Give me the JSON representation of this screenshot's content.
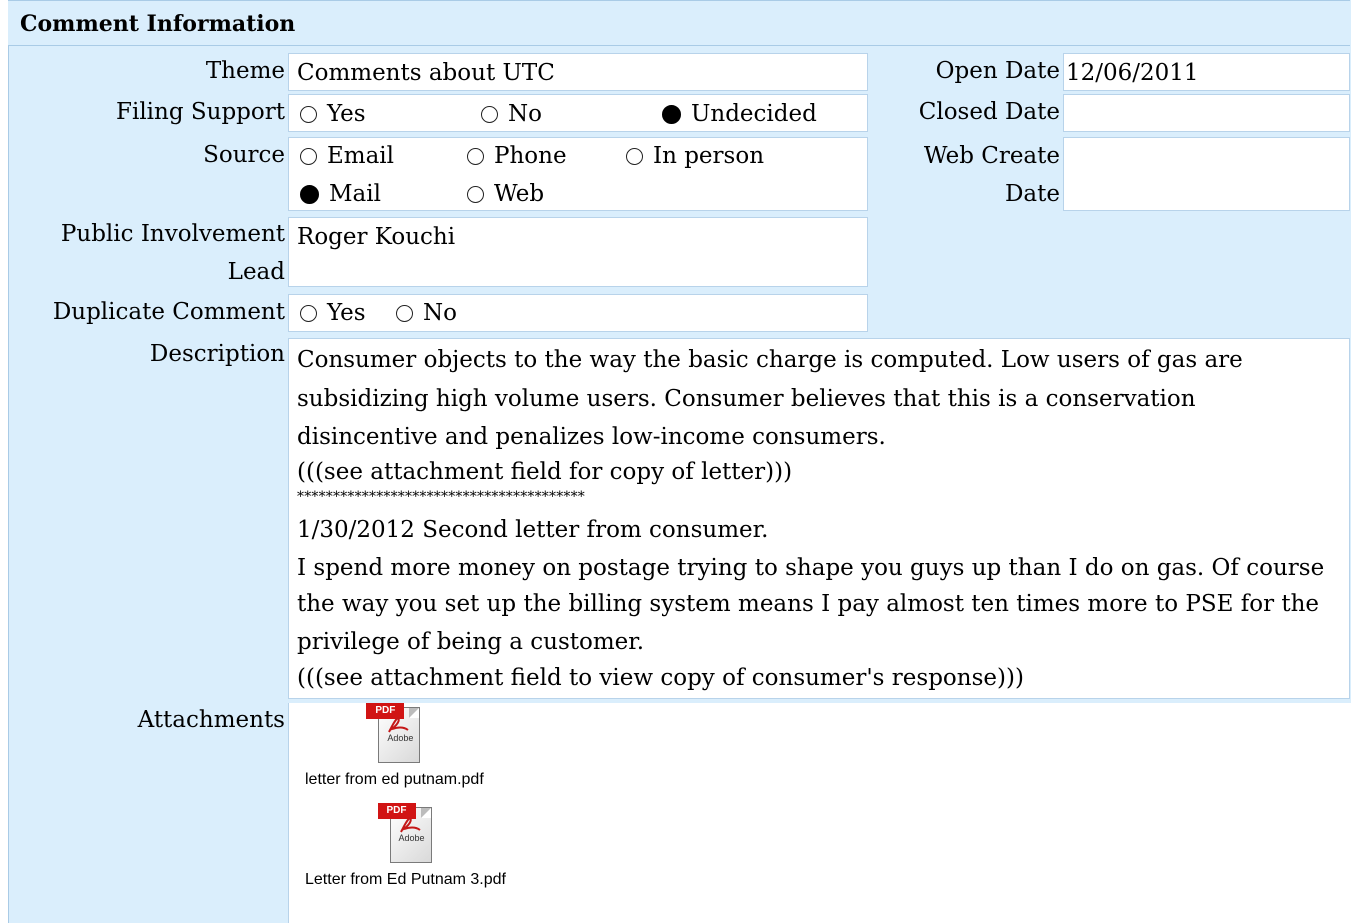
{
  "section_title": "Comment Information",
  "fields": {
    "theme": {
      "label": "Theme",
      "value": "Comments about UTC"
    },
    "open_date": {
      "label": "Open Date",
      "value": "12/06/2011"
    },
    "filing_support": {
      "label": "Filing Support",
      "options": [
        {
          "label": "Yes",
          "selected": false
        },
        {
          "label": "No",
          "selected": false
        },
        {
          "label": "Undecided",
          "selected": true
        }
      ]
    },
    "closed_date": {
      "label": "Closed Date",
      "value": ""
    },
    "source": {
      "label": "Source",
      "options": [
        {
          "label": "Email",
          "selected": false
        },
        {
          "label": "Phone",
          "selected": false
        },
        {
          "label": "In person",
          "selected": false
        },
        {
          "label": "Mail",
          "selected": true
        },
        {
          "label": "Web",
          "selected": false
        }
      ]
    },
    "web_create_date": {
      "label_line1": "Web Create",
      "label_line2": "Date",
      "value": ""
    },
    "public_involvement_lead": {
      "label_line1": "Public Involvement",
      "label_line2": "Lead",
      "value": "Roger Kouchi"
    },
    "duplicate_comment": {
      "label": "Duplicate Comment",
      "options": [
        {
          "label": "Yes",
          "selected": false
        },
        {
          "label": "No",
          "selected": false
        }
      ]
    },
    "description": {
      "label": "Description",
      "lines": [
        " Consumer objects to the way the basic charge is computed. Low users of gas are",
        "subsidizing high volume users. Consumer believes that this is a conservation",
        "disincentive and penalizes low-income consumers.",
        "(((see attachment field for copy of letter)))",
        "****************************************",
        "1/30/2012 Second letter from consumer.",
        "I spend more money on postage trying to shape you guys up than I do on gas. Of course",
        "the way you set up the billing system means I pay almost ten times more to PSE for the",
        "privilege of being a customer.",
        "(((see attachment field to view copy of consumer's response)))"
      ]
    },
    "attachments": {
      "label": "Attachments",
      "files": [
        {
          "name": "letter from ed putnam.pdf",
          "icon": "pdf-file-icon",
          "badge": "PDF",
          "brand": "Adobe"
        },
        {
          "name": "Letter from Ed Putnam 3.pdf",
          "icon": "pdf-file-icon",
          "badge": "PDF",
          "brand": "Adobe"
        }
      ]
    }
  },
  "colors": {
    "panel_bg": "#daeefc",
    "border": "#a9cbe6",
    "field_bg": "#ffffff"
  }
}
